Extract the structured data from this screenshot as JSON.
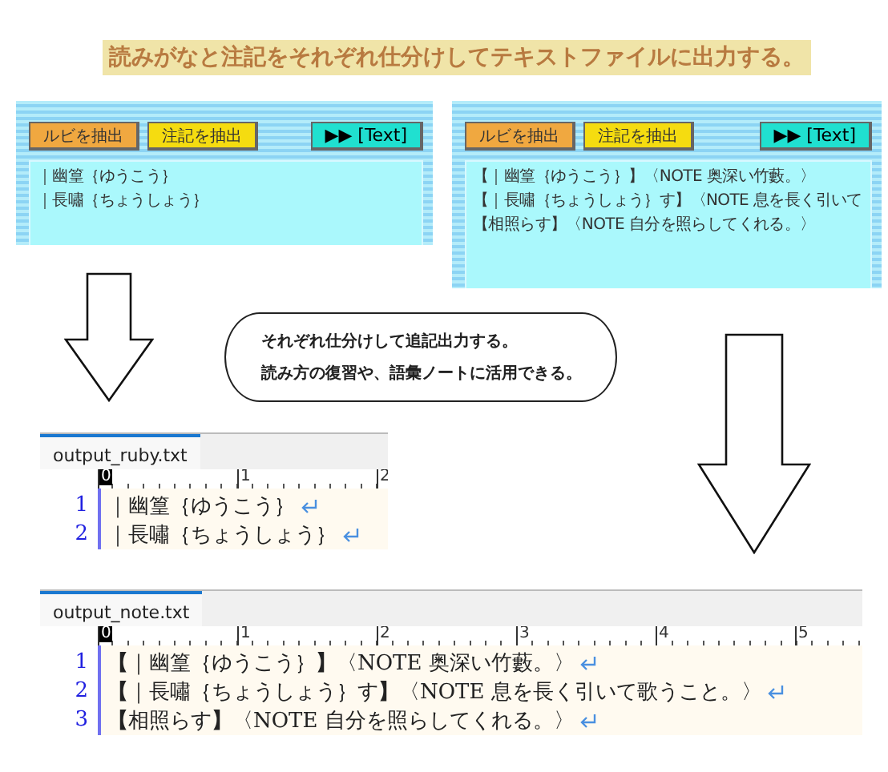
{
  "banner": {
    "text": "読みがなと注記をそれぞれ仕分けしてテキストファイルに出力する。"
  },
  "panels": [
    {
      "buttons": [
        {
          "label": "ルビを抽出",
          "kind": "ruby"
        },
        {
          "label": "注記を抽出",
          "kind": "note"
        },
        {
          "label": "▶▶ [Text]",
          "kind": "export"
        }
      ],
      "lines": [
        "｜幽篁｛ゆうこう｝",
        "｜長嘯｛ちょうしょう｝"
      ]
    },
    {
      "buttons": [
        {
          "label": "ルビを抽出",
          "kind": "ruby"
        },
        {
          "label": "注記を抽出",
          "kind": "note"
        },
        {
          "label": "▶▶ [Text]",
          "kind": "export"
        }
      ],
      "lines": [
        "【｜幽篁｛ゆうこう｝】〈NOTE 奥深い竹藪。〉",
        "【｜長嘯｛ちょうしょう｝す】〈NOTE 息を長く引いて",
        "【相照らす】〈NOTE 自分を照らしてくれる。〉"
      ]
    }
  ],
  "callout": {
    "lines": [
      "それぞれ仕分けして追記出力する。",
      "読み方の復習や、語彙ノートに活用できる。"
    ]
  },
  "editors": [
    {
      "tab": "output_ruby.txt",
      "ruler": [
        "0",
        "1",
        "2"
      ],
      "lines": [
        {
          "number": "1",
          "text": "｜幽篁｛ゆうこう｝"
        },
        {
          "number": "2",
          "text": "｜長嘯｛ちょうしょう｝"
        }
      ]
    },
    {
      "tab": "output_note.txt",
      "ruler": [
        "0",
        "1",
        "2",
        "3",
        "4",
        "5"
      ],
      "lines": [
        {
          "number": "1",
          "text": "**【**｜幽篁｛ゆうこう｝**】**〈NOTE 奥深い竹藪。〉"
        },
        {
          "number": "2",
          "text": "**【**｜長嘯｛ちょうしょう｝す**】**〈NOTE 息を長く引いて歌うこと。〉"
        },
        {
          "number": "3",
          "text": "**【**相照らす**】**〈NOTE 自分を照らしてくれる。〉"
        }
      ]
    }
  ]
}
